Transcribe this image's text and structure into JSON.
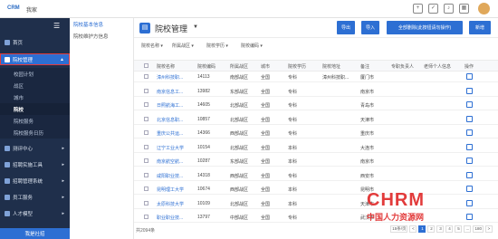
{
  "topbar": {
    "logo": "CRM",
    "brand": "我家",
    "icons": [
      "add-icon",
      "check-icon",
      "bell-icon",
      "grid-icon"
    ]
  },
  "sidebar": {
    "collapse_icon": "☰",
    "items": [
      {
        "label": "首页",
        "icon": "home-icon"
      },
      {
        "label": "院校管理",
        "icon": "school-icon",
        "caret": "▲"
      },
      {
        "label": "测评中心",
        "icon": "test-icon",
        "caret": "▸"
      },
      {
        "label": "招聘实施工具",
        "icon": "tool-icon",
        "caret": "▸"
      },
      {
        "label": "招聘管理系统",
        "icon": "system-icon",
        "caret": "▸"
      },
      {
        "label": "员工服务",
        "icon": "service-icon",
        "caret": "▸"
      },
      {
        "label": "人才模型",
        "icon": "model-icon",
        "caret": "▸"
      }
    ],
    "subitems": [
      "校园计划",
      "战区",
      "城市",
      "院校",
      "院校服务",
      "院校服务日历"
    ],
    "bottom": "我是社招"
  },
  "subnav": {
    "items": [
      "院校基本信息",
      "院校维护方信息"
    ]
  },
  "main": {
    "title": "院校管理",
    "buttons": [
      "导出",
      "导入",
      "全部删除(此按钮请勿操作)",
      "新增"
    ],
    "filters": [
      "院校名称 ▾",
      "所属战区 ▾",
      "院校学历 ▾",
      "院校编码 ▾"
    ],
    "columns": [
      "院校名称",
      "院校编码",
      "所属战区",
      "城市",
      "院校学历",
      "院校地址",
      "备注",
      "专职负责人",
      "老师个人信息",
      "操作"
    ],
    "rows": [
      [
        "漳州科技职...",
        "14113",
        "南部战区",
        "全国",
        "专科",
        "漳州科技职...",
        "厦门市"
      ],
      [
        "南京信息工...",
        "13982",
        "东部战区",
        "全国",
        "专科",
        "",
        "南京市"
      ],
      [
        "日照航海工...",
        "14605",
        "北部战区",
        "全国",
        "专科",
        "",
        "青岛市"
      ],
      [
        "北京信息职...",
        "10857",
        "北部战区",
        "全国",
        "专科",
        "",
        "天津市"
      ],
      [
        "重庆公共运...",
        "14366",
        "西部战区",
        "全国",
        "专科",
        "",
        "重庆市"
      ],
      [
        "辽宁工业大学",
        "10154",
        "北部战区",
        "全国",
        "本科",
        "",
        "大连市"
      ],
      [
        "南京航空航...",
        "10287",
        "东部战区",
        "全国",
        "本科",
        "",
        "南京市"
      ],
      [
        "咸阳职业技...",
        "14318",
        "西部战区",
        "全国",
        "专科",
        "",
        "西安市"
      ],
      [
        "昆明理工大学",
        "10674",
        "西部战区",
        "全国",
        "本科",
        "",
        "昆明市"
      ],
      [
        "太原科技大学",
        "10109",
        "北部战区",
        "全国",
        "本科",
        "",
        "天津市"
      ],
      [
        "职业职业技...",
        "13797",
        "中部战区",
        "全国",
        "专科",
        "",
        "武汉市"
      ]
    ],
    "total": "共2094条",
    "pager": {
      "size": "15条/页",
      "pages": [
        "<",
        "1",
        "2",
        "3",
        "4",
        "5",
        "...",
        "180",
        ">"
      ],
      "current": "1"
    }
  },
  "watermark": {
    "big": "CHRM",
    "cn": "中国人力资源网"
  },
  "colors": {
    "primary": "#2d6fd3",
    "sidebar": "#1f2f4b",
    "highlight": "#e23b3b"
  }
}
